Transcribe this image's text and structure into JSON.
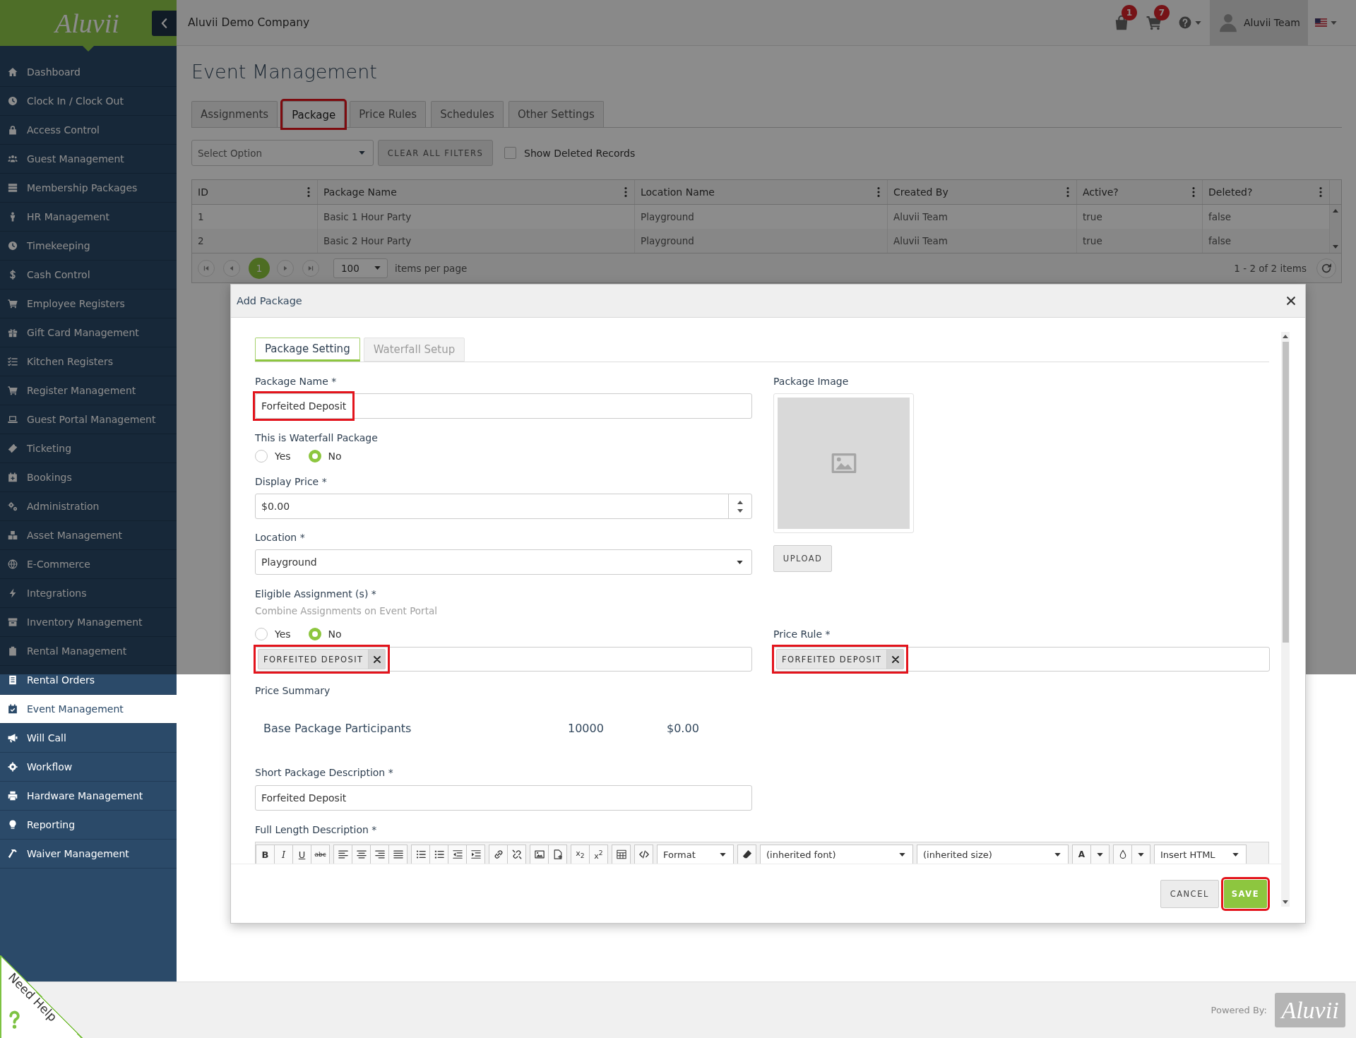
{
  "sidebar": {
    "brand": "Aluvii",
    "items": [
      {
        "label": "Dashboard",
        "selected": false
      },
      {
        "label": "Clock In / Clock Out",
        "selected": false
      },
      {
        "label": "Access Control",
        "selected": false
      },
      {
        "label": "Guest Management",
        "selected": false
      },
      {
        "label": "Membership Packages",
        "selected": false
      },
      {
        "label": "HR Management",
        "selected": false
      },
      {
        "label": "Timekeeping",
        "selected": false
      },
      {
        "label": "Cash Control",
        "selected": false
      },
      {
        "label": "Employee Registers",
        "selected": false
      },
      {
        "label": "Gift Card Management",
        "selected": false
      },
      {
        "label": "Kitchen Registers",
        "selected": false
      },
      {
        "label": "Register Management",
        "selected": false
      },
      {
        "label": "Guest Portal Management",
        "selected": false
      },
      {
        "label": "Ticketing",
        "selected": false
      },
      {
        "label": "Bookings",
        "selected": false
      },
      {
        "label": "Administration",
        "selected": false
      },
      {
        "label": "Asset Management",
        "selected": false
      },
      {
        "label": "E-Commerce",
        "selected": false
      },
      {
        "label": "Integrations",
        "selected": false
      },
      {
        "label": "Inventory Management",
        "selected": false
      },
      {
        "label": "Rental Management",
        "selected": false
      },
      {
        "label": "Rental Orders",
        "selected": false
      },
      {
        "label": "Event Management",
        "selected": true
      },
      {
        "label": "Will Call",
        "selected": false
      },
      {
        "label": "Workflow",
        "selected": false
      },
      {
        "label": "Hardware Management",
        "selected": false
      },
      {
        "label": "Reporting",
        "selected": false
      },
      {
        "label": "Waiver Management",
        "selected": false
      }
    ]
  },
  "top_bar": {
    "company": "Aluvii Demo Company",
    "notification_badges": [
      "1",
      "7"
    ],
    "user": "Aluvii Team"
  },
  "page": {
    "title": "Event Management",
    "tabs": [
      {
        "label": "Assignments",
        "selected": false,
        "annotated": false
      },
      {
        "label": "Package",
        "selected": true,
        "annotated": true
      },
      {
        "label": "Price Rules",
        "selected": false,
        "annotated": false
      },
      {
        "label": "Schedules",
        "selected": false,
        "annotated": false
      },
      {
        "label": "Other Settings",
        "selected": false,
        "annotated": false
      }
    ],
    "filters": {
      "option_select": {
        "placeholder": "Select Option"
      },
      "clear_button": "CLEAR ALL FILTERS",
      "show_deleted": {
        "label": "Show Deleted Records",
        "checked": false
      }
    },
    "table": {
      "columns": [
        "ID",
        "Package Name",
        "Location Name",
        "Created By",
        "Active?",
        "Deleted?"
      ],
      "rows": [
        [
          "1",
          "Basic 1 Hour Party",
          "Playground",
          "Aluvii Team",
          "true",
          "false"
        ],
        [
          "2",
          "Basic 2 Hour Party",
          "Playground",
          "Aluvii Team",
          "true",
          "false"
        ]
      ]
    },
    "pager": {
      "pages": [
        {
          "label": "1",
          "selected": true
        }
      ],
      "page_size": "100",
      "page_size_label": "items per page",
      "summary": "1 - 2 of 2 items"
    }
  },
  "dialog": {
    "title": "Add Package",
    "tabs": [
      {
        "label": "Package Setting",
        "selected": true,
        "disabled": false
      },
      {
        "label": "Waterfall Setup",
        "selected": false,
        "disabled": true
      }
    ],
    "package_name": {
      "label": "Package Name *",
      "value": "Forfeited Deposit",
      "annotated": true
    },
    "waterfall_package": {
      "label": "This is Waterfall Package",
      "options": [
        {
          "label": "Yes",
          "selected": false
        },
        {
          "label": "No",
          "selected": true
        }
      ]
    },
    "display_price": {
      "label": "Display Price *",
      "value": "$0.00"
    },
    "location": {
      "label": "Location *",
      "value": "Playground"
    },
    "eligible_assignments": {
      "label": "Eligible Assignment (s) *",
      "hint": "Combine Assignments on Event Portal",
      "options": [
        {
          "label": "Yes",
          "selected": false
        },
        {
          "label": "No",
          "selected": true
        }
      ],
      "tags": [
        {
          "label": "FORFEITED DEPOSIT",
          "annotated": true
        }
      ]
    },
    "package_image": {
      "label": "Package Image",
      "upload_button": "UPLOAD"
    },
    "price_rule": {
      "label": "Price Rule *",
      "tags": [
        {
          "label": "FORFEITED DEPOSIT",
          "annotated": true
        }
      ]
    },
    "price_summary": {
      "label": "Price Summary",
      "rows": [
        [
          "Base Package Participants",
          "10000",
          "$0.00"
        ]
      ]
    },
    "short_description": {
      "label": "Short Package Description *",
      "value": "Forfeited Deposit"
    },
    "full_description": {
      "label": "Full Length Description *",
      "toolbar": {
        "style_buttons": [
          "B",
          "I",
          "U",
          "abc"
        ],
        "script_buttons": [
          "x$_{2}$",
          "x$^{2}$"
        ],
        "format": "Format",
        "font": "(inherited font)",
        "size": "(inherited size)",
        "text_color": "A",
        "insert_html": "Insert HTML"
      }
    },
    "buttons": [
      {
        "label": "CANCEL",
        "kind": "secondary",
        "annotated": false
      },
      {
        "label": "SAVE",
        "kind": "primary",
        "annotated": true
      }
    ]
  },
  "footer": {
    "help_tab": "Need Help",
    "powered_by": "Powered By:",
    "brand": "Aluvii"
  }
}
